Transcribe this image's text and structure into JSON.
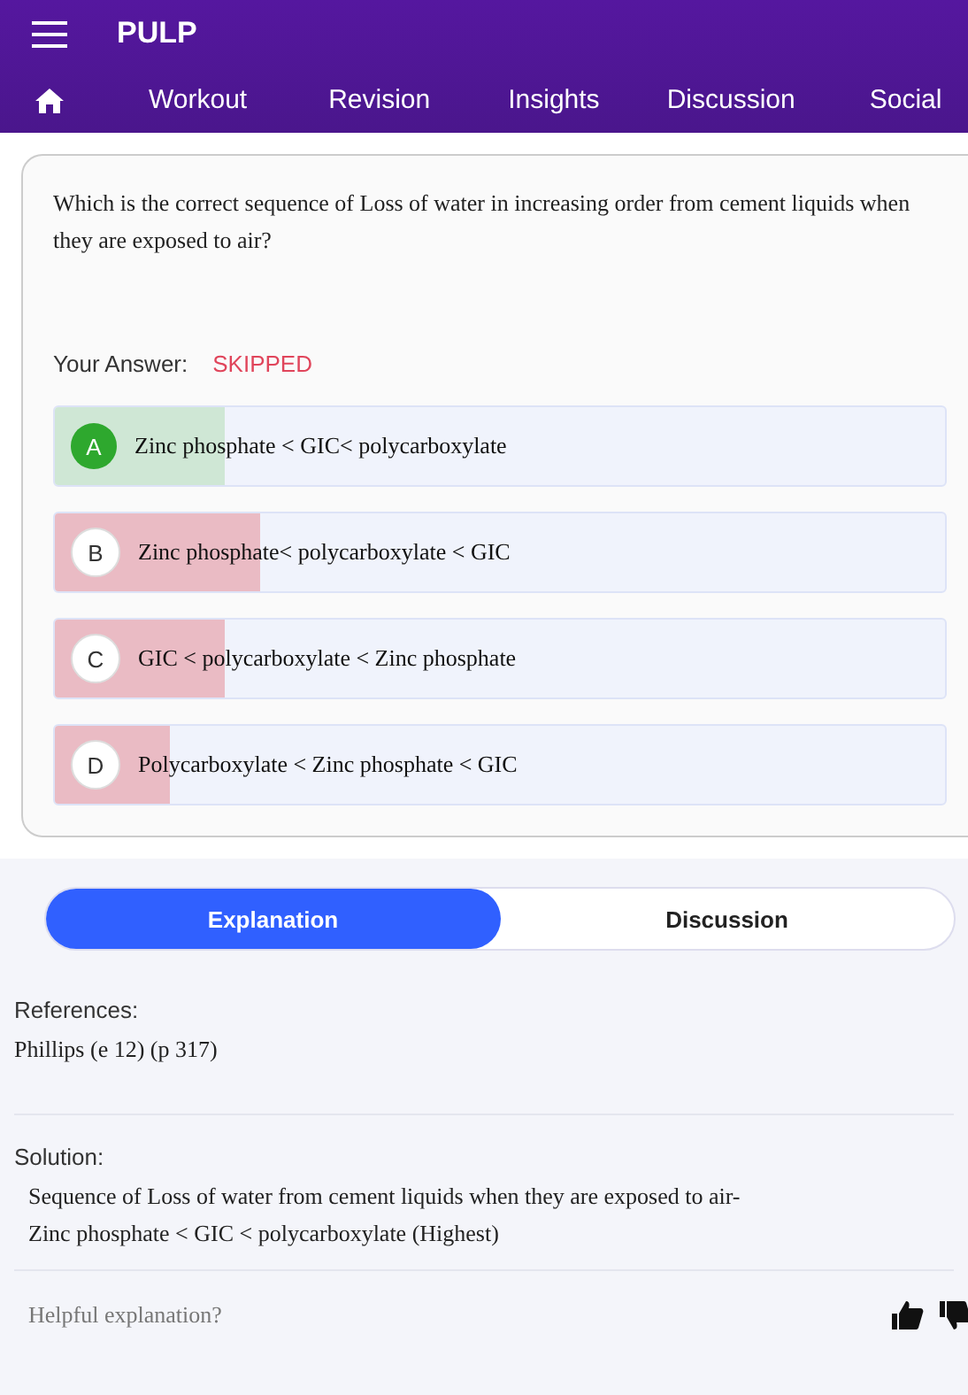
{
  "app": {
    "title": "PULP"
  },
  "nav": [
    "Workout",
    "Revision",
    "Insights",
    "Discussion",
    "Social"
  ],
  "question": {
    "text": "Which is the correct sequence of Loss of water in increasing order from cement liquids when they are exposed to air?",
    "answer_label": "Your Answer:",
    "answer_value": "SKIPPED",
    "options": [
      {
        "letter": "A",
        "text": "Zinc phosphate < GIC< polycarboxylate",
        "correct": true,
        "level": 0.19
      },
      {
        "letter": "B",
        "text": "Zinc phosphate< polycarboxylate < GIC",
        "correct": false,
        "level": 0.23
      },
      {
        "letter": "C",
        "text": "GIC < polycarboxylate < Zinc phosphate",
        "correct": false,
        "level": 0.19
      },
      {
        "letter": "D",
        "text": "Polycarboxylate < Zinc phosphate < GIC",
        "correct": false,
        "level": 0.13
      }
    ]
  },
  "tabs": [
    {
      "label": "Explanation",
      "selected": true
    },
    {
      "label": "Discussion",
      "selected": false
    }
  ],
  "references": {
    "heading": "References:",
    "text": "Phillips (e 12) (p 317)"
  },
  "solution": {
    "heading": "Solution:",
    "lines": [
      "Sequence of Loss of water from cement liquids when they are exposed to air-",
      "Zinc phosphate < GIC < polycarboxylate (Highest)"
    ]
  },
  "feedback": {
    "prompt": "Helpful explanation?"
  }
}
